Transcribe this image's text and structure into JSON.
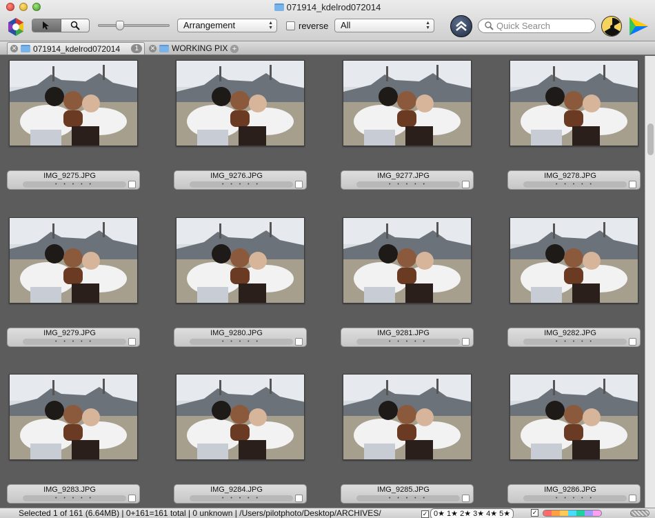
{
  "window": {
    "title": "071914_kdelrod072014"
  },
  "toolbar": {
    "arrangement_label": "Arrangement",
    "reverse_label": "reverse",
    "filter_value": "All",
    "search_placeholder": "Quick Search"
  },
  "tabs": [
    {
      "label": "071914_kdelrod072014",
      "count": "1"
    },
    {
      "label": "WORKING PIX"
    }
  ],
  "photos": [
    {
      "filename": "IMG_9275.JPG",
      "rating": "• • • • •"
    },
    {
      "filename": "IMG_9276.JPG",
      "rating": "• • • • •"
    },
    {
      "filename": "IMG_9277.JPG",
      "rating": "• • • • •"
    },
    {
      "filename": "IMG_9278.JPG",
      "rating": "• • • • •"
    },
    {
      "filename": "IMG_9279.JPG",
      "rating": "• • • • •"
    },
    {
      "filename": "IMG_9280.JPG",
      "rating": "• • • • •"
    },
    {
      "filename": "IMG_9281.JPG",
      "rating": "• • • • •"
    },
    {
      "filename": "IMG_9282.JPG",
      "rating": "• • • • •"
    },
    {
      "filename": "IMG_9283.JPG",
      "rating": "• • • • •"
    },
    {
      "filename": "IMG_9284.JPG",
      "rating": "• • • • •"
    },
    {
      "filename": "IMG_9285.JPG",
      "rating": "• • • • •"
    },
    {
      "filename": "IMG_9286.JPG",
      "rating": "• • • • •"
    }
  ],
  "statusbar": {
    "text": "Selected 1 of 161 (6.64MB) | 0+161=161 total | 0 unknown | /Users/pilotphoto/Desktop/ARCHIVES/",
    "star_filter": "0★ 1★ 2★ 3★ 4★ 5★"
  },
  "colors": {
    "background": "#5c5c5c",
    "label_colors": [
      "#ff6b6b",
      "#ff9f43",
      "#feca57",
      "#48dbfb",
      "#1dd1a1",
      "#a29bfe",
      "#ff9ff3"
    ]
  }
}
